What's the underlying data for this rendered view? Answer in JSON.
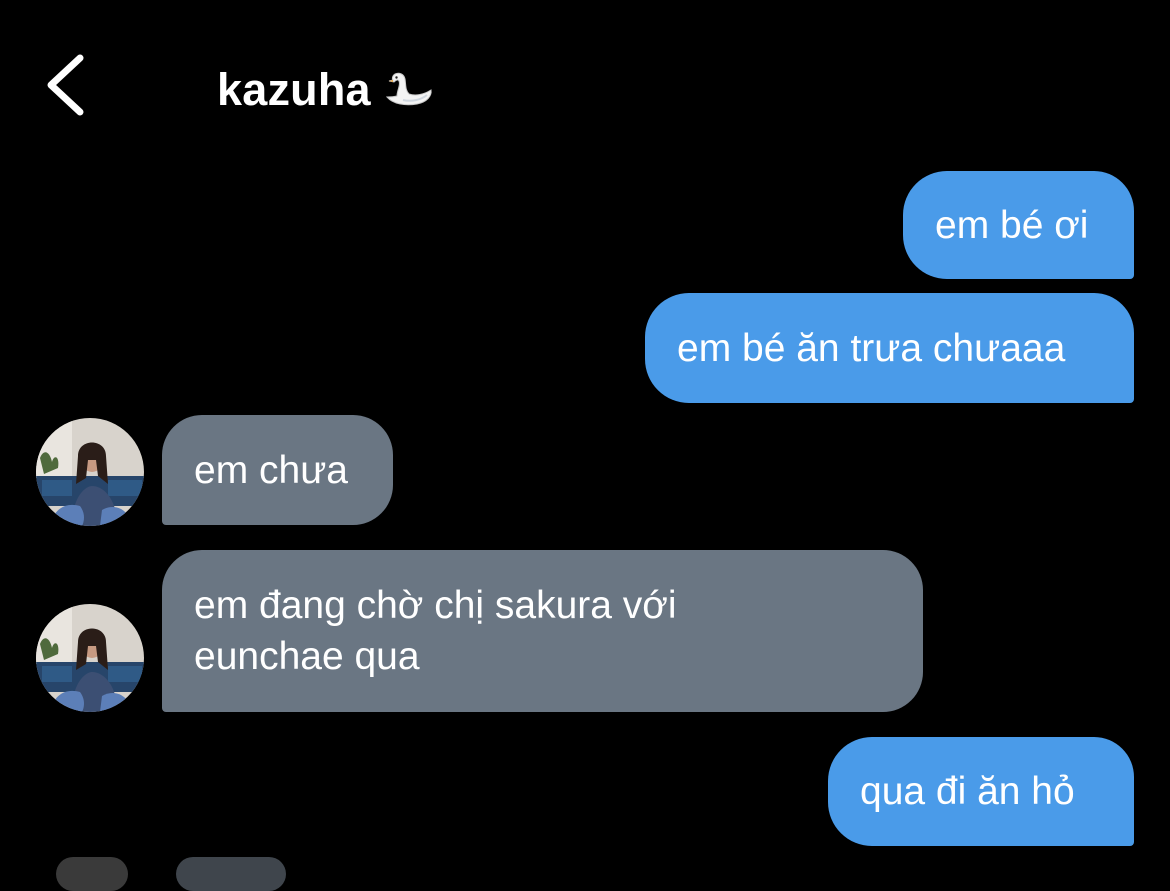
{
  "header": {
    "back_icon": "chevron-left-icon",
    "contact_name": "kazuha",
    "name_emoji_icon": "swan-icon"
  },
  "messages": [
    {
      "direction": "outgoing",
      "text": "em bé ơi"
    },
    {
      "direction": "outgoing",
      "text": "em bé ăn trưa chưaaa"
    },
    {
      "direction": "incoming",
      "text": "em chưa"
    },
    {
      "direction": "incoming",
      "lines": [
        "em đang chờ chị sakura với",
        "eunchae qua"
      ]
    },
    {
      "direction": "outgoing",
      "text": "qua đi ăn hỏ"
    }
  ],
  "colors": {
    "background": "#000000",
    "outgoing_bubble": "#4a9be9",
    "incoming_bubble": "#6a7683",
    "text": "#ffffff"
  }
}
